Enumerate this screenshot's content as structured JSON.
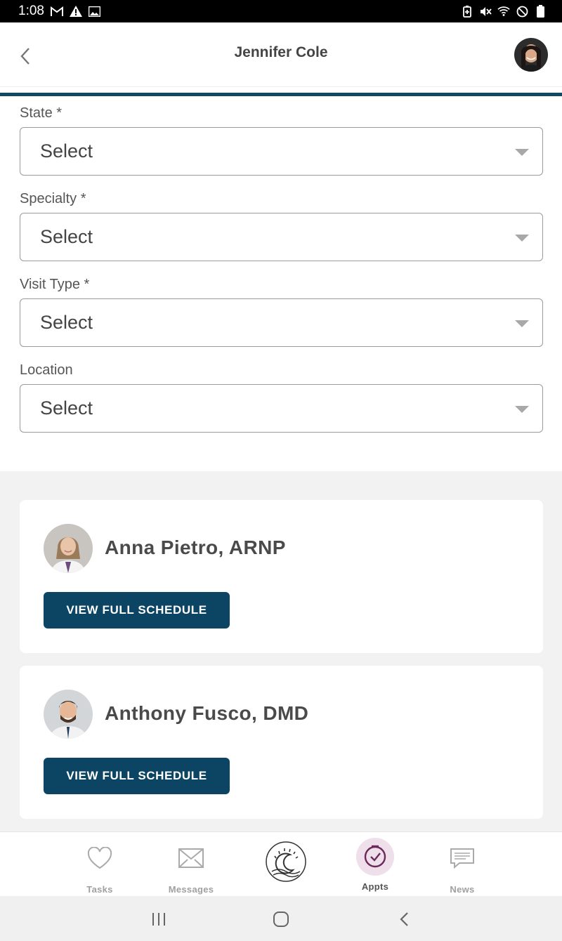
{
  "status_bar": {
    "time": "1:08",
    "left_icons": [
      "gmail-icon",
      "warning-icon",
      "image-icon"
    ],
    "right_icons": [
      "battery-saver-icon",
      "vibrate-mute-icon",
      "wifi-icon",
      "do-not-disturb-icon",
      "battery-icon"
    ]
  },
  "header": {
    "title": "Jennifer Cole",
    "back_icon": "chevron-left-icon",
    "avatar": "user-avatar"
  },
  "form": {
    "fields": [
      {
        "label": "State *",
        "value": "Select"
      },
      {
        "label": "Specialty *",
        "value": "Select"
      },
      {
        "label": "Visit Type *",
        "value": "Select"
      },
      {
        "label": "Location",
        "value": "Select"
      }
    ]
  },
  "providers": [
    {
      "name": "Anna Pietro, ARNP",
      "button": "VIEW FULL SCHEDULE"
    },
    {
      "name": "Anthony Fusco, DMD",
      "button": "VIEW FULL SCHEDULE"
    }
  ],
  "bottom_nav": {
    "items": [
      {
        "label": "Tasks",
        "icon": "heart-icon",
        "active": false
      },
      {
        "label": "Messages",
        "icon": "envelope-icon",
        "active": false
      },
      {
        "label": "",
        "icon": "app-logo-icon",
        "active": false
      },
      {
        "label": "Appts",
        "icon": "clock-check-icon",
        "active": true
      },
      {
        "label": "News",
        "icon": "chat-bubble-icon",
        "active": false
      }
    ]
  },
  "colors": {
    "primary": "#0c4564",
    "accent_line": "#0e4a63",
    "active_nav": "#6b2a5b",
    "active_nav_bg": "#efdfea"
  }
}
